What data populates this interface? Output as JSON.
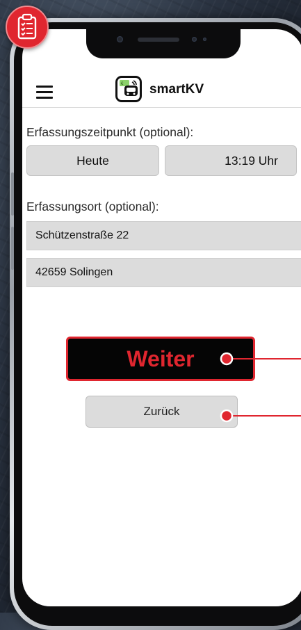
{
  "app": {
    "title": "smartKV"
  },
  "capture_time": {
    "label": "Erfassungszeitpunkt (optional):",
    "date_value": "Heute",
    "time_value": "13:19 Uhr"
  },
  "capture_location": {
    "label": "Erfassungsort (optional):",
    "street": "Schützenstraße 22",
    "city": "42659 Solingen"
  },
  "actions": {
    "next_label": "Weiter",
    "back_label": "Zurück"
  },
  "icons": {
    "menu": "hamburger-menu-icon",
    "app_logo": "smartkv-logo-icon",
    "badge": "clipboard-checklist-icon"
  },
  "colors": {
    "accent": "#e0262f",
    "button_bg": "#dcdcdc",
    "primary_button_bg": "#050505"
  }
}
